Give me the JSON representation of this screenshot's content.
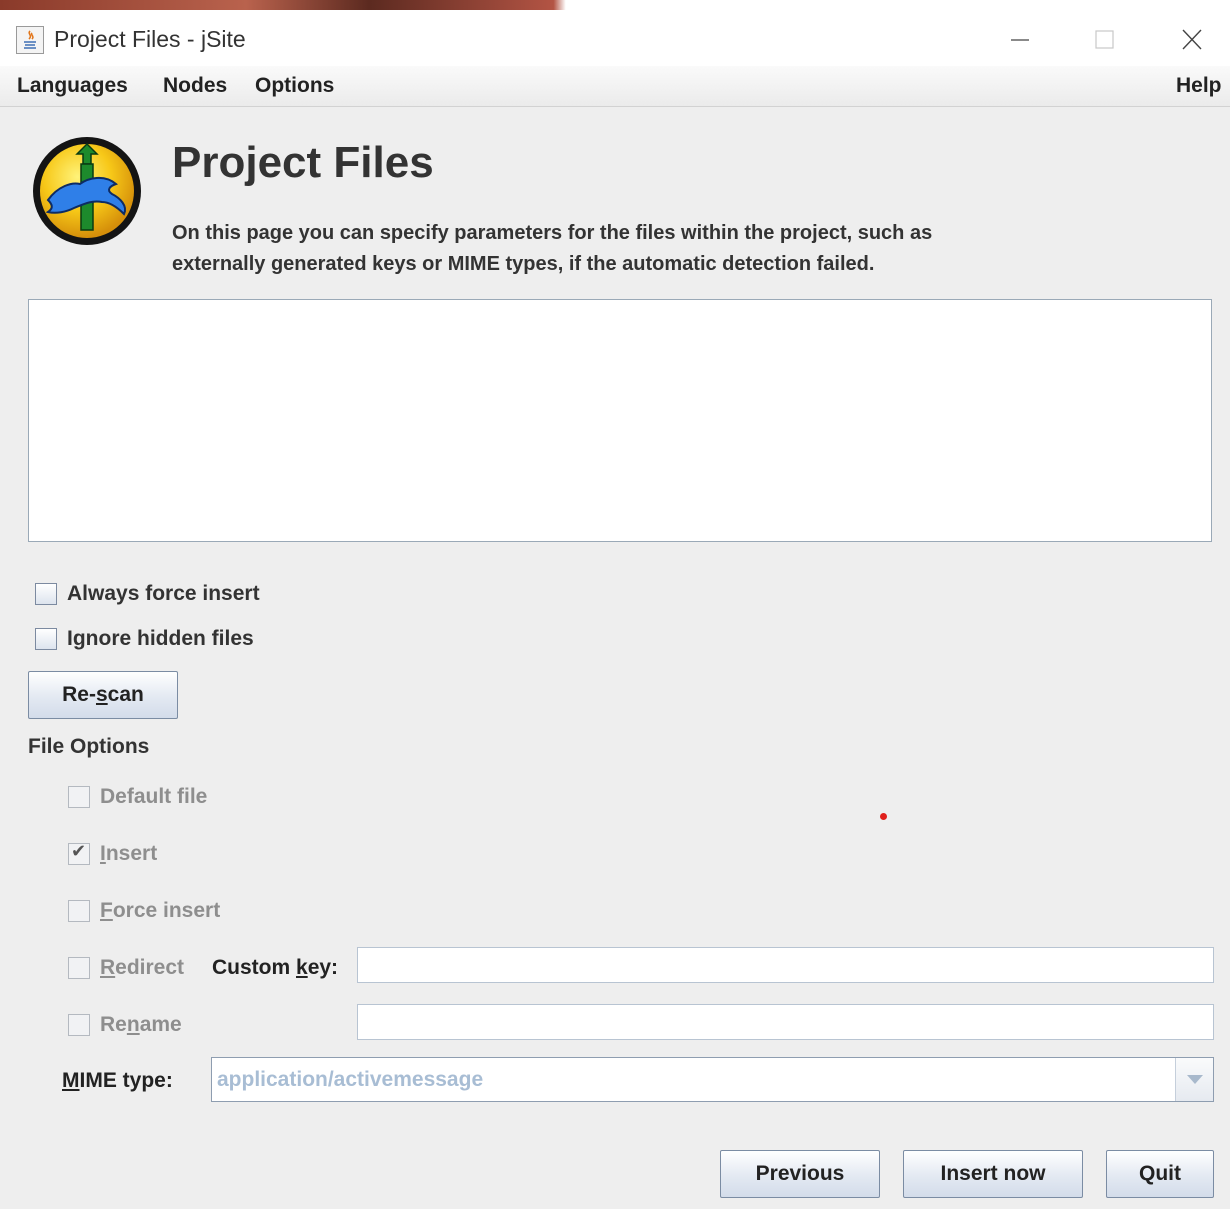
{
  "window": {
    "title": "Project Files - jSite"
  },
  "menu": {
    "languages": "Languages",
    "nodes": "Nodes",
    "options": "Options",
    "help": "Help"
  },
  "header": {
    "title": "Project Files",
    "description_line1": "On this page you can specify parameters for the files within the project, such as",
    "description_line2": "externally generated keys or MIME types, if the automatic detection failed."
  },
  "project_options": {
    "always_force_insert": {
      "label": "Always force insert",
      "checked": false
    },
    "ignore_hidden_files": {
      "label": "Ignore hidden files",
      "checked": false
    },
    "rescan_button": {
      "before": "Re-",
      "mnemonic": "s",
      "after": "can"
    }
  },
  "file_options": {
    "title": "File Options",
    "default_file": {
      "label": "Default file",
      "checked": false
    },
    "insert": {
      "mnemonic": "I",
      "rest": "nsert",
      "checked": true
    },
    "force_insert": {
      "mnemonic": "F",
      "rest": "orce insert",
      "checked": false
    },
    "redirect": {
      "mnemonic": "R",
      "rest": "edirect",
      "checked": false
    },
    "custom_key": {
      "before": "Custom ",
      "mnemonic": "k",
      "after": "ey:",
      "value": ""
    },
    "rename": {
      "before": "Re",
      "mnemonic": "n",
      "after": "ame",
      "checked": false,
      "value": ""
    },
    "mime_type": {
      "mnemonic": "M",
      "rest": "IME type:",
      "value": "application/activemessage"
    }
  },
  "footer": {
    "previous": "Previous",
    "insert_now": "Insert now",
    "quit": "Quit"
  },
  "colors": {
    "accent_border": "#7b8ca3",
    "disabled_text": "#8e8e8e",
    "combo_text": "#a8bdd4",
    "indicator_dot": "#e0201c"
  }
}
